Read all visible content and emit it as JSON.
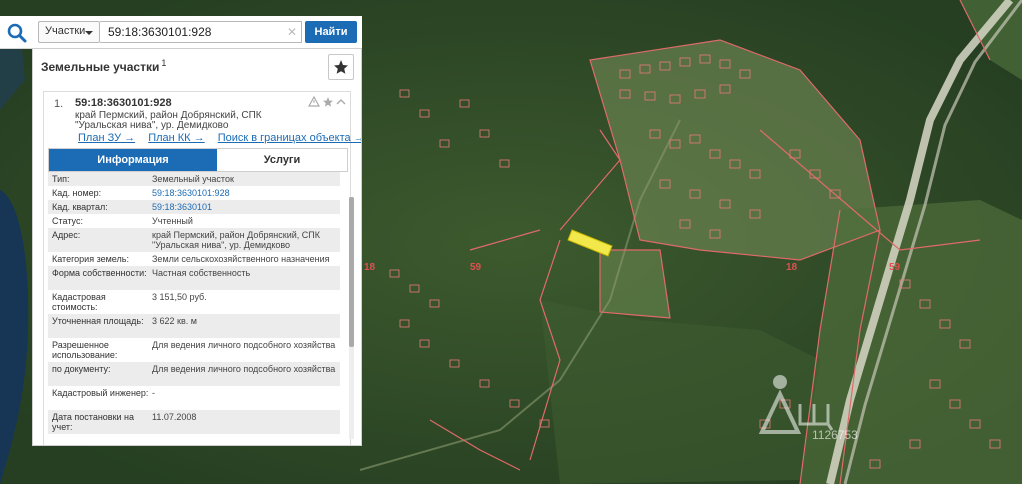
{
  "search": {
    "type_select": "Участки",
    "query": "59:18:3630101:928",
    "find_label": "Найти"
  },
  "panel": {
    "title": "Земельные участки",
    "title_sup": "1"
  },
  "card": {
    "index": "1.",
    "cad_number": "59:18:3630101:928",
    "address_line1": "край Пермский, район Добрянский, СПК",
    "address_line2": "\"Уральская нива\", ур. Демидково",
    "links": [
      "План ЗУ →",
      "План КК →",
      "Поиск в границах объекта →"
    ]
  },
  "tabs": {
    "info": "Информация",
    "services": "Услуги"
  },
  "rows": [
    {
      "key": "Тип:",
      "value": "Земельный участок"
    },
    {
      "key": "Кад. номер:",
      "value": "59:18:3630101:928",
      "link": true
    },
    {
      "key": "Кад. квартал:",
      "value": "59:18:3630101",
      "link": true
    },
    {
      "key": "Статус:",
      "value": "Учтенный"
    },
    {
      "key": "Адрес:",
      "value": "край Пермский, район Добрянский, СПК \"Уральская нива\", ур. Демидково"
    },
    {
      "key": "Категория земель:",
      "value": "Земли сельскохозяйственного назначения"
    },
    {
      "key": "Форма собственности:",
      "value": "Частная собственность"
    },
    {
      "key": "Кадастровая стоимость:",
      "value": "3 151,50 руб."
    },
    {
      "key": "Уточненная площадь:",
      "value": "3 622 кв. м"
    },
    {
      "key": "Разрешенное использование:",
      "value": "Для ведения личного подсобного хозяйства"
    },
    {
      "key": "по документу:",
      "value": "Для ведения личного подсобного хозяйства"
    },
    {
      "key": "Кадастровый инженер:",
      "value": "-"
    },
    {
      "key": "Дата постановки на учет:",
      "value": "11.07.2008"
    }
  ],
  "map": {
    "labels": [
      "59",
      "59",
      "18",
      "18"
    ],
    "watermark_id": "1126753"
  },
  "colors": {
    "accent": "#1c6bb5",
    "parcel_line": "#e06a6a",
    "highlight": "#f2e84b"
  }
}
